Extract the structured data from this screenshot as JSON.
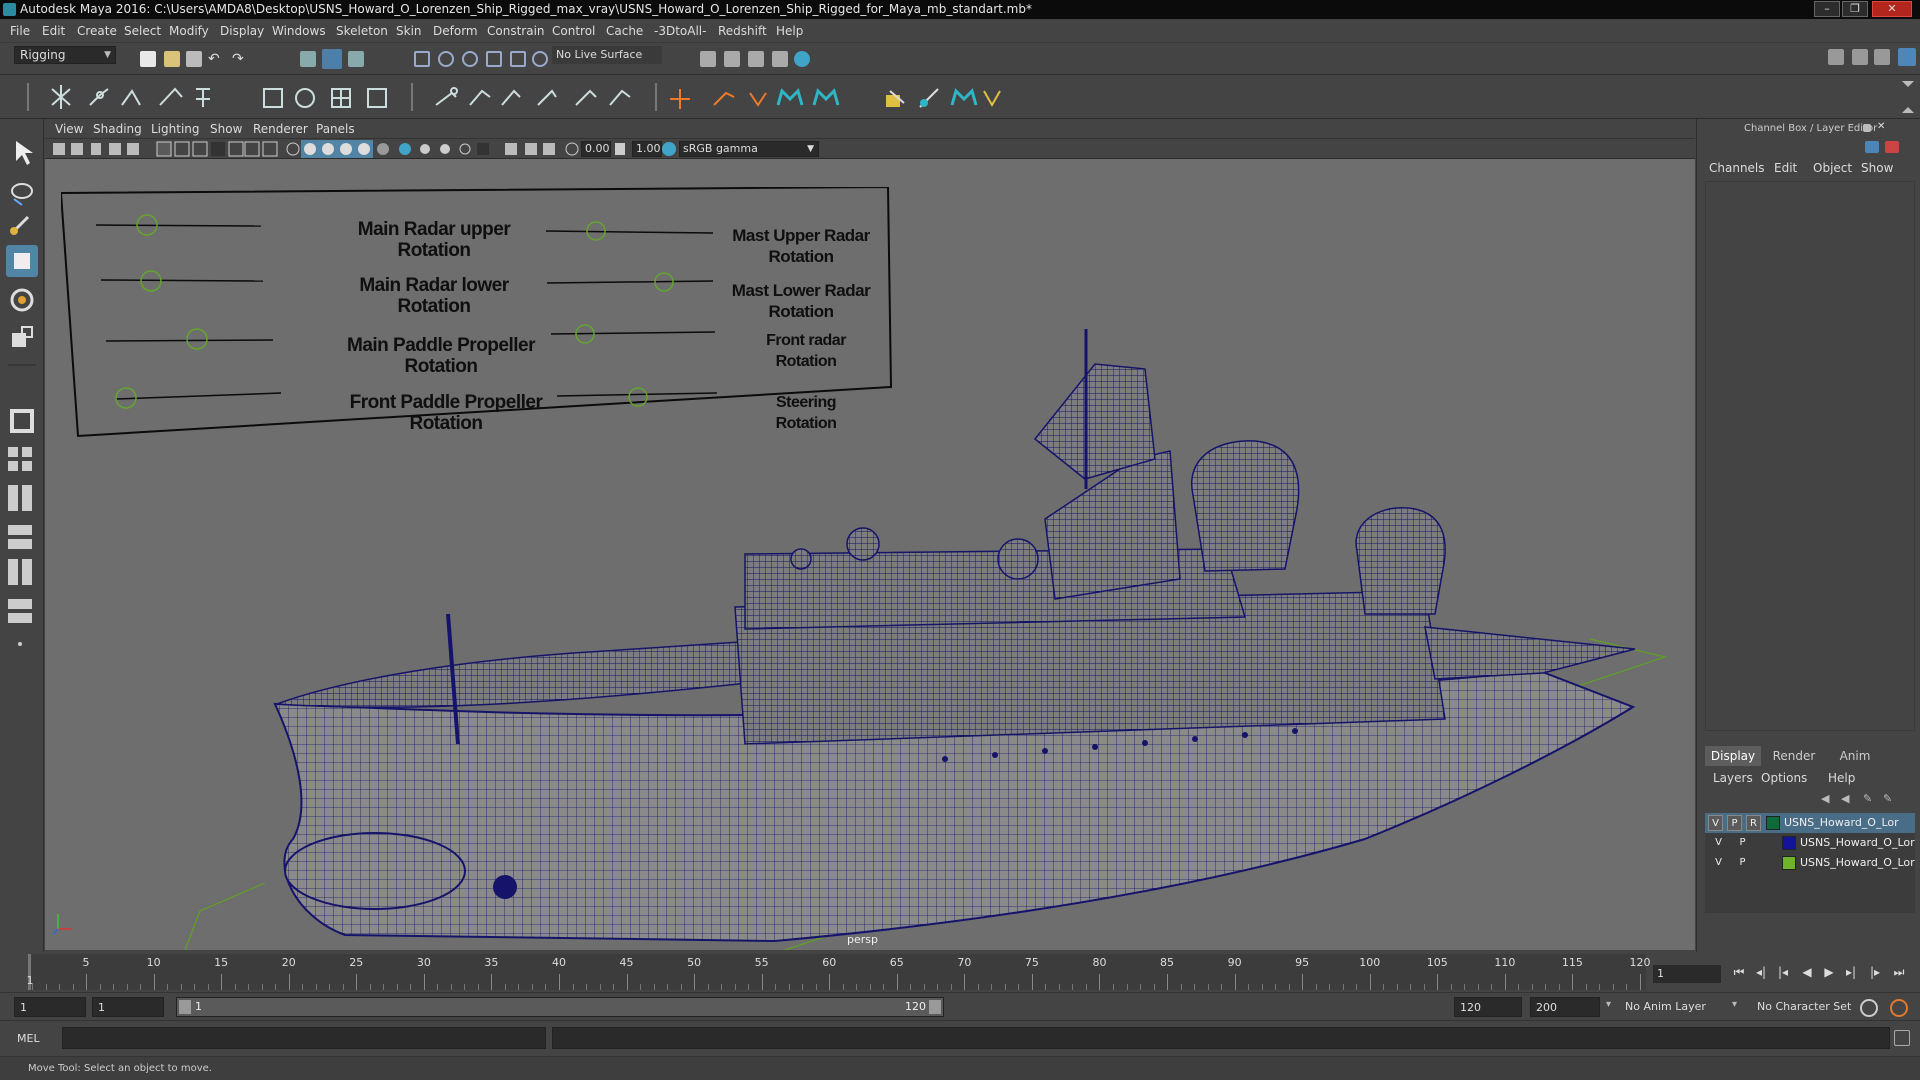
{
  "window": {
    "title": "Autodesk Maya 2016: C:\\Users\\AMDA8\\Desktop\\USNS_Howard_O_Lorenzen_Ship_Rigged_max_vray\\USNS_Howard_O_Lorenzen_Ship_Rigged_for_Maya_mb_standart.mb*"
  },
  "menubar": [
    "File",
    "Edit",
    "Create",
    "Select",
    "Modify",
    "Display",
    "Windows",
    "Skeleton",
    "Skin",
    "Deform",
    "Constrain",
    "Control",
    "Cache",
    "-3DtoAll-",
    "Redshift",
    "Help"
  ],
  "status": {
    "mode": "Rigging",
    "live_surface": "No Live Surface"
  },
  "panel_menu": [
    "View",
    "Shading",
    "Lighting",
    "Show",
    "Renderer",
    "Panels"
  ],
  "panel_tools": {
    "exposure": "0.00",
    "gamma": "1.00",
    "color_space": "sRGB gamma"
  },
  "viewport": {
    "camera": "persp",
    "rig_labels": [
      "Main Radar upper\nRotation",
      "Main Radar lower\nRotation",
      "Main Paddle Propeller\nRotation",
      "Front Paddle Propeller\nRotation",
      "Mast Upper Radar\nRotation",
      "Mast Lower Radar\nRotation",
      "Front radar\nRotation",
      "Steering\nRotation"
    ]
  },
  "channel_box": {
    "title": "Channel Box / Layer Editor",
    "tabs": [
      "Channels",
      "Edit",
      "Object",
      "Show"
    ]
  },
  "layer_editor": {
    "tabs": [
      "Display",
      "Render",
      "Anim"
    ],
    "active_tab": "Display",
    "menu": [
      "Layers",
      "Options",
      "Help"
    ],
    "layers": [
      {
        "v": "V",
        "p": "P",
        "r": "R",
        "color": "#0d6b3a",
        "name": "USNS_Howard_O_Loren",
        "selected": true
      },
      {
        "v": "V",
        "p": "P",
        "r": "",
        "color": "#14149a",
        "name": "USNS_Howard_O_Lore",
        "selected": false
      },
      {
        "v": "V",
        "p": "P",
        "r": "",
        "color": "#6fb32a",
        "name": "USNS_Howard_O_Lore",
        "selected": false
      }
    ]
  },
  "timeline": {
    "ticks": [
      "5",
      "10",
      "15",
      "20",
      "25",
      "30",
      "35",
      "40",
      "45",
      "50",
      "55",
      "60",
      "65",
      "70",
      "75",
      "80",
      "85",
      "90",
      "95",
      "100",
      "105",
      "110",
      "115",
      "120"
    ],
    "start_label": "1",
    "current_frame": "1"
  },
  "range": {
    "start": "1",
    "inner_start": "1",
    "slider_start": "1",
    "slider_end": "120",
    "end": "120",
    "max": "200",
    "anim_layer": "No Anim Layer",
    "char_set": "No Character Set"
  },
  "command": {
    "lang": "MEL"
  },
  "help_line": "Move Tool: Select an object to move."
}
